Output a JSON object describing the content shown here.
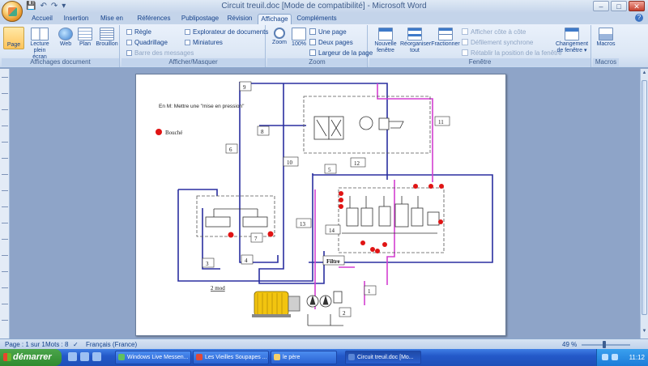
{
  "window": {
    "title": "Circuit treuil.doc [Mode de compatibilité] - Microsoft Word",
    "controls": {
      "minimize": "–",
      "maximize": "□",
      "close": "✕"
    }
  },
  "qat": {
    "save": "💾",
    "undo": "↶",
    "redo": "↷",
    "more": "▾"
  },
  "tabs": [
    "Accueil",
    "Insertion",
    "Mise en page",
    "Références",
    "Publipostage",
    "Révision",
    "Affichage",
    "Compléments"
  ],
  "active_tab": "Affichage",
  "ribbon": {
    "views": {
      "label": "Affichages document",
      "buttons": [
        "Page",
        "Lecture plein écran",
        "Web",
        "Plan",
        "Brouillon"
      ]
    },
    "show": {
      "label": "Afficher/Masquer",
      "checks": [
        {
          "text": "Règle",
          "enabled": true
        },
        {
          "text": "Quadrillage",
          "enabled": true
        },
        {
          "text": "Barre des messages",
          "enabled": false
        },
        {
          "text": "Explorateur de documents",
          "enabled": true
        },
        {
          "text": "Miniatures",
          "enabled": true
        }
      ]
    },
    "zoom": {
      "label": "Zoom",
      "zoom_btn": "Zoom",
      "hundred_btn": "100%",
      "one_page": "Une page",
      "two_pages": "Deux pages",
      "page_width": "Largeur de la page"
    },
    "window": {
      "label": "Fenêtre",
      "new_window": "Nouvelle fenêtre",
      "arrange": "Réorganiser tout",
      "split": "Fractionner",
      "side_by_side": "Afficher côte à côte",
      "sync_scroll": "Défilement synchrone",
      "reset_pos": "Rétablir la position de la fenêtre",
      "switch": "Changement de fenêtre ▾"
    },
    "macros": {
      "label": "Macros",
      "btn": "Macros"
    }
  },
  "document": {
    "note": "En M: Mettre une \"mise en pression\"",
    "legend_label": "Bouché",
    "filter_label": "Filtre",
    "motor_label": "2 mod",
    "numbers": [
      "1",
      "2",
      "3",
      "4",
      "5",
      "6",
      "7",
      "8",
      "9",
      "10",
      "11",
      "12",
      "13",
      "14"
    ],
    "colors": {
      "blue": "#2a2fa0",
      "magenta": "#d33fd1",
      "red": "#e01414",
      "motor": "#f2c40f"
    }
  },
  "status": {
    "page": "Page : 1 sur 1",
    "words": "Mots : 8",
    "language": "Français (France)",
    "zoom": "49 %"
  },
  "taskbar": {
    "start": "démarrer",
    "items": [
      "Windows Live Messen...",
      "Les Vieilles Soupapes ...",
      "le père",
      "Circuit treuil.doc [Mo..."
    ],
    "clock": "11:12"
  }
}
